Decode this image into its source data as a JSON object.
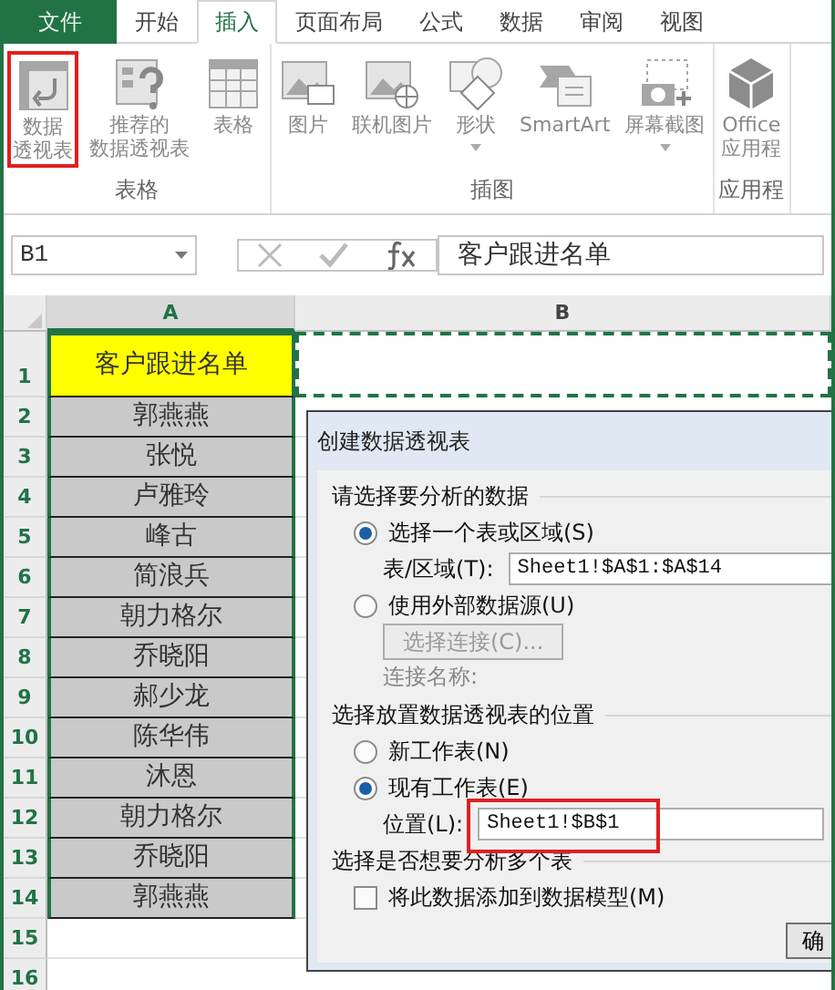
{
  "ribbon_tabs": [
    {
      "label": "文件",
      "kind": "file",
      "selected": false
    },
    {
      "label": "开始",
      "kind": "tab",
      "selected": false
    },
    {
      "label": "插入",
      "kind": "tab",
      "selected": true
    },
    {
      "label": "页面布局",
      "kind": "tab",
      "selected": false
    },
    {
      "label": "公式",
      "kind": "tab",
      "selected": false
    },
    {
      "label": "数据",
      "kind": "tab",
      "selected": false
    },
    {
      "label": "审阅",
      "kind": "tab",
      "selected": false
    },
    {
      "label": "视图",
      "kind": "tab",
      "selected": false
    }
  ],
  "ribbon_groups": [
    {
      "label": "表格",
      "commands": [
        {
          "label_lines": [
            "数据",
            "透视表"
          ],
          "highlighted": true,
          "dropdown": false
        },
        {
          "label_lines": [
            "推荐的",
            "数据透视表"
          ],
          "highlighted": false,
          "dropdown": false
        },
        {
          "label_lines": [
            "表格"
          ],
          "highlighted": false,
          "dropdown": false
        }
      ]
    },
    {
      "label": "插图",
      "commands": [
        {
          "label_lines": [
            "图片"
          ],
          "highlighted": false,
          "dropdown": false
        },
        {
          "label_lines": [
            "联机图片"
          ],
          "highlighted": false,
          "dropdown": false
        },
        {
          "label_lines": [
            "形状"
          ],
          "highlighted": false,
          "dropdown": true
        },
        {
          "label_lines": [
            "SmartArt"
          ],
          "highlighted": false,
          "dropdown": false
        },
        {
          "label_lines": [
            "屏幕截图"
          ],
          "highlighted": false,
          "dropdown": true
        }
      ]
    },
    {
      "label": "应用程",
      "commands": [
        {
          "label_lines": [
            "Office",
            "应用程"
          ],
          "highlighted": false,
          "dropdown": false
        }
      ]
    }
  ],
  "formula_bar": {
    "name_box": "B1",
    "formula": "客户跟进名单"
  },
  "columns": [
    {
      "label": "A",
      "selected": true
    },
    {
      "label": "B",
      "selected": false
    }
  ],
  "rows": [
    {
      "number": "1",
      "cell_a": "客户跟进名单",
      "kind": "title"
    },
    {
      "number": "2",
      "cell_a": "郭燕燕",
      "kind": "name"
    },
    {
      "number": "3",
      "cell_a": "张悦",
      "kind": "name"
    },
    {
      "number": "4",
      "cell_a": "卢雅玲",
      "kind": "name"
    },
    {
      "number": "5",
      "cell_a": "峰古",
      "kind": "name"
    },
    {
      "number": "6",
      "cell_a": "简浪兵",
      "kind": "name"
    },
    {
      "number": "7",
      "cell_a": "朝力格尔",
      "kind": "name"
    },
    {
      "number": "8",
      "cell_a": "乔晓阳",
      "kind": "name"
    },
    {
      "number": "9",
      "cell_a": "郝少龙",
      "kind": "name"
    },
    {
      "number": "10",
      "cell_a": "陈华伟",
      "kind": "name"
    },
    {
      "number": "11",
      "cell_a": "沐恩",
      "kind": "name"
    },
    {
      "number": "12",
      "cell_a": "朝力格尔",
      "kind": "name"
    },
    {
      "number": "13",
      "cell_a": "乔晓阳",
      "kind": "name"
    },
    {
      "number": "14",
      "cell_a": "郭燕燕",
      "kind": "name"
    },
    {
      "number": "15",
      "cell_a": "",
      "kind": "empty"
    },
    {
      "number": "16",
      "cell_a": "",
      "kind": "empty"
    }
  ],
  "dialog": {
    "title": "创建数据透视表",
    "source_heading": "请选择要分析的数据",
    "source_options": [
      {
        "label": "选择一个表或区域(S)",
        "selected": true
      },
      {
        "label": "使用外部数据源(U)",
        "selected": false
      }
    ],
    "table_range": {
      "label": "表/区域(T):",
      "value": "Sheet1!$A$1:$A$14"
    },
    "connection_button": {
      "label": "选择连接(C)...",
      "disabled": true
    },
    "connection_name_label": "连接名称:",
    "location_heading": "选择放置数据透视表的位置",
    "location_options": [
      {
        "label": "新工作表(N)",
        "selected": false
      },
      {
        "label": "现有工作表(E)",
        "selected": true
      }
    ],
    "location": {
      "label": "位置(L):",
      "value": "Sheet1!$B$1",
      "highlighted": true
    },
    "multi_heading": "选择是否想要分析多个表",
    "data_model": {
      "label": "将此数据添加到数据模型(M)",
      "checked": false
    },
    "ok_button": "确"
  }
}
